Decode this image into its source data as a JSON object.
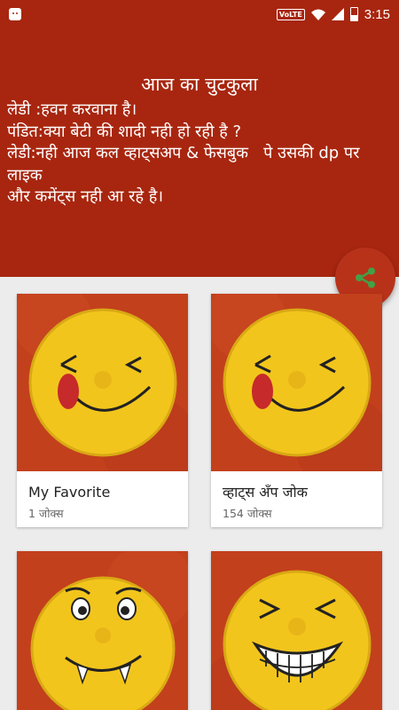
{
  "status_bar": {
    "network": "VoLTE",
    "time": "3:15"
  },
  "header": {
    "title": "आज का चुटकुला",
    "joke": "लेडी :हवन करवाना है।\nपंडित:क्या बेटी की शादी नही हो रही है ?\nलेडी:नही आज कल व्हाट्सअप & फेसबुक   पे उसकी dp पर लाइक\nऔर कमेंट्स नही आ रहे है।"
  },
  "share_button": {
    "icon": "share-icon",
    "color": "#b8321a"
  },
  "categories": [
    {
      "title": "My Favorite",
      "count": "1 जोक्स",
      "image": "tongue-smiley"
    },
    {
      "title": "व्हाट्स अँप जोक",
      "count": "154 जोक्स",
      "image": "tongue-smiley"
    },
    {
      "title": "",
      "count": "",
      "image": "fanged-smiley"
    },
    {
      "title": "",
      "count": "",
      "image": "toothy-smiley"
    }
  ],
  "colors": {
    "primary": "#a8260f",
    "accent": "#43a047",
    "card_bg": "#ffffff"
  }
}
